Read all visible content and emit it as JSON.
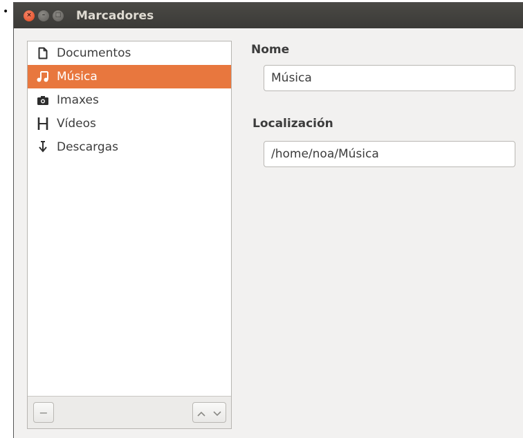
{
  "window": {
    "title": "Marcadores",
    "close_glyph": "×",
    "min_glyph": "–",
    "max_glyph": "□"
  },
  "sidebar": {
    "items": [
      {
        "label": "Documentos",
        "icon": "document-icon",
        "selected": false
      },
      {
        "label": "Música",
        "icon": "music-note-icon",
        "selected": true
      },
      {
        "label": "Imaxes",
        "icon": "camera-icon",
        "selected": false
      },
      {
        "label": "Vídeos",
        "icon": "film-icon",
        "selected": false
      },
      {
        "label": "Descargas",
        "icon": "download-arrow-icon",
        "selected": false
      }
    ],
    "remove_glyph": "−"
  },
  "details": {
    "name_label": "Nome",
    "name_value": "Música",
    "location_label": "Localización",
    "location_value": "/home/noa/Música"
  },
  "colors": {
    "selection": "#e8773e",
    "titlebar": "#3c3b37",
    "window_bg": "#f2f1f0"
  }
}
